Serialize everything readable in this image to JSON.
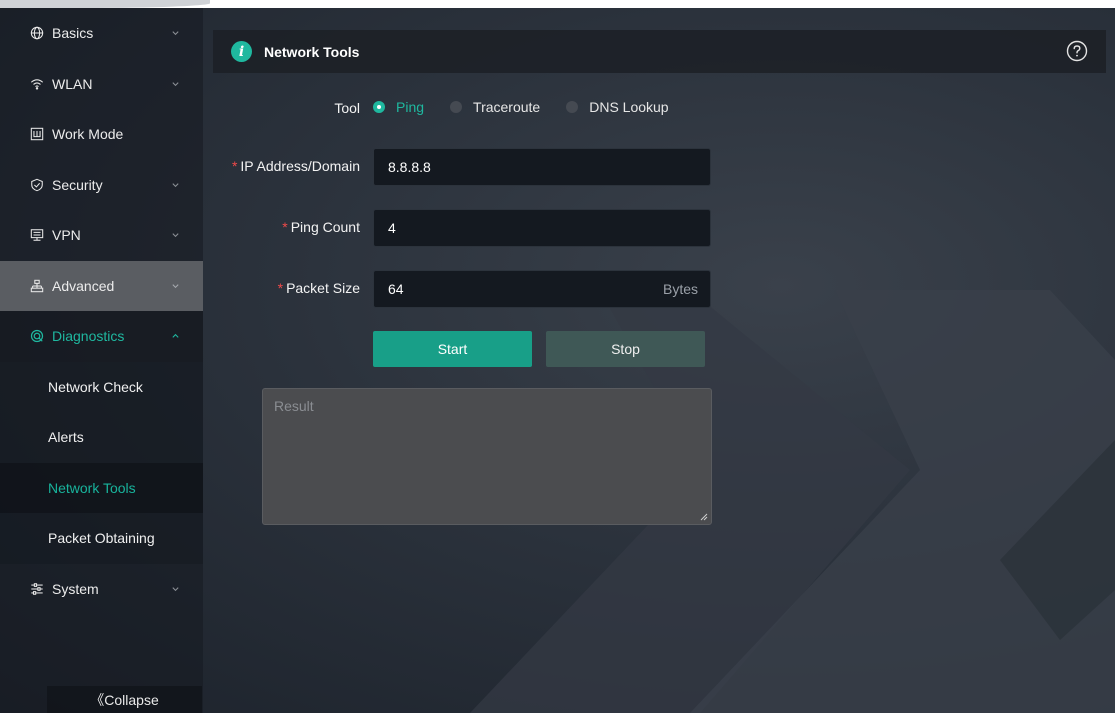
{
  "sidebar": {
    "items": [
      {
        "label": "Basics",
        "icon": "globe-icon"
      },
      {
        "label": "WLAN",
        "icon": "wifi-icon"
      },
      {
        "label": "Work Mode",
        "icon": "mode-icon"
      },
      {
        "label": "Security",
        "icon": "shield-icon"
      },
      {
        "label": "VPN",
        "icon": "vpn-icon"
      },
      {
        "label": "Advanced",
        "icon": "network-icon"
      },
      {
        "label": "Diagnostics",
        "icon": "diagnostics-icon"
      },
      {
        "label": "System",
        "icon": "settings-icon"
      }
    ],
    "diagnostics_sub": [
      {
        "label": "Network Check"
      },
      {
        "label": "Alerts"
      },
      {
        "label": "Network Tools"
      },
      {
        "label": "Packet Obtaining"
      }
    ],
    "collapse_label": "《Collapse"
  },
  "header": {
    "title": "Network Tools",
    "info_glyph": "i"
  },
  "form": {
    "tool_label": "Tool",
    "tools": [
      {
        "label": "Ping",
        "checked": true
      },
      {
        "label": "Traceroute",
        "checked": false
      },
      {
        "label": "DNS Lookup",
        "checked": false
      }
    ],
    "ip_label": "IP Address/Domain",
    "ip_value": "8.8.8.8",
    "count_label": "Ping Count",
    "count_value": "4",
    "size_label": "Packet Size",
    "size_value": "64",
    "size_suffix": "Bytes",
    "required_mark": "*",
    "start_label": "Start",
    "stop_label": "Stop",
    "result_placeholder": "Result"
  },
  "colors": {
    "accent": "#1fb89f",
    "required": "#f04a4a",
    "active_bg": "#5a5d62"
  }
}
